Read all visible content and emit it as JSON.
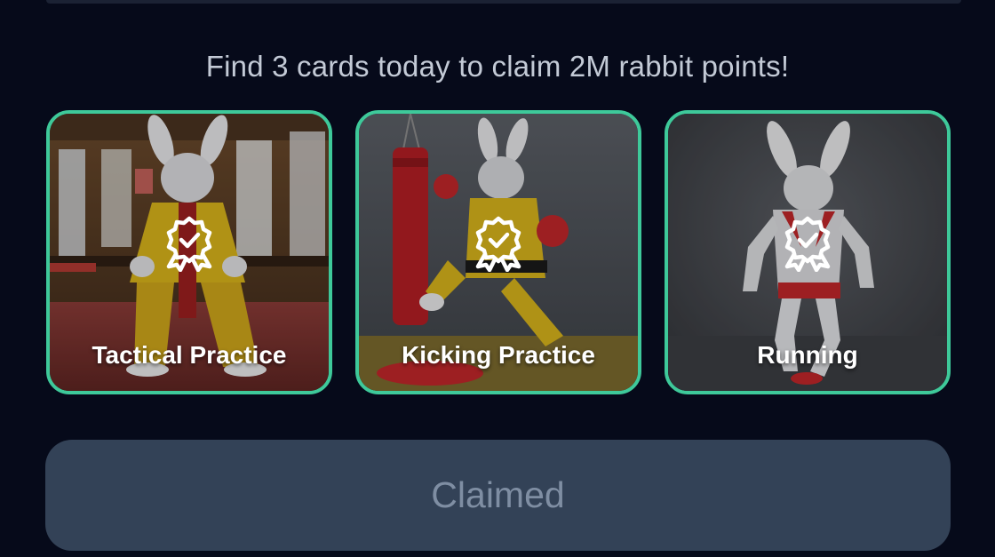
{
  "headline": "Find 3 cards today to claim 2M rabbit points!",
  "cards": [
    {
      "label": "Tactical Practice",
      "icon": "award-check-icon",
      "image": "rabbit-in-yellow-gi-dojo"
    },
    {
      "label": "Kicking Practice",
      "icon": "award-check-icon",
      "image": "rabbit-kicking-punching-bag"
    },
    {
      "label": "Running",
      "icon": "award-check-icon",
      "image": "rabbit-running"
    }
  ],
  "claim_button": {
    "label": "Claimed"
  },
  "colors": {
    "background": "#060a1a",
    "card_border": "#3ec99a",
    "button_bg": "#334257",
    "button_text": "#7f8ea3",
    "headline_text": "#c3cad6"
  }
}
